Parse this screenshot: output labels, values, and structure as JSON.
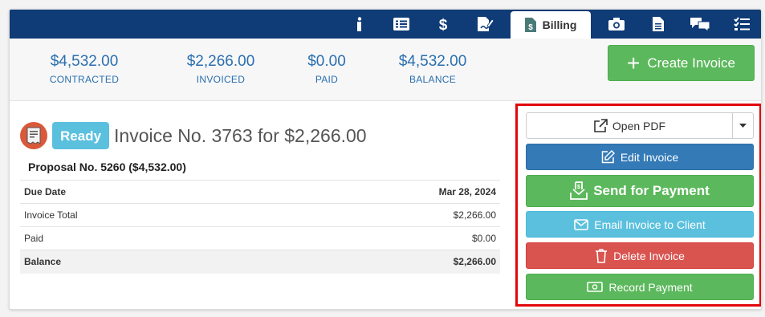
{
  "nav": {
    "tabs": [
      {
        "icon": "info-icon"
      },
      {
        "icon": "list-icon"
      },
      {
        "icon": "dollar-icon"
      },
      {
        "icon": "signature-icon"
      },
      {
        "icon": "invoice-dollar-icon",
        "label": "Billing",
        "active": true
      },
      {
        "icon": "camera-icon"
      },
      {
        "icon": "document-icon"
      },
      {
        "icon": "chat-icon"
      },
      {
        "icon": "checklist-icon"
      }
    ]
  },
  "summary": {
    "contracted": {
      "value": "$4,532.00",
      "label": "CONTRACTED"
    },
    "invoiced": {
      "value": "$2,266.00",
      "label": "INVOICED"
    },
    "paid": {
      "value": "$0.00",
      "label": "PAID"
    },
    "balance": {
      "value": "$4,532.00",
      "label": "BALANCE"
    },
    "create_label": "Create Invoice"
  },
  "invoice": {
    "status": "Ready",
    "title": "Invoice No. 3763 for $2,266.00",
    "proposal": "Proposal No. 5260 ($4,532.00)",
    "rows": [
      {
        "label": "Due Date",
        "value": "Mar 28, 2024"
      },
      {
        "label": "Invoice Total",
        "value": "$2,266.00"
      },
      {
        "label": "Paid",
        "value": "$0.00"
      },
      {
        "label": "Balance",
        "value": "$2,266.00"
      }
    ]
  },
  "actions": {
    "open_pdf": "Open PDF",
    "edit": "Edit Invoice",
    "send": "Send for Payment",
    "email": "Email Invoice to Client",
    "delete": "Delete Invoice",
    "record": "Record Payment"
  },
  "colors": {
    "navbar": "#0f3b76",
    "primary": "#337ab7",
    "success": "#5cb85c",
    "info": "#5bc0de",
    "danger": "#d9534f",
    "highlight": "#e2070b"
  }
}
